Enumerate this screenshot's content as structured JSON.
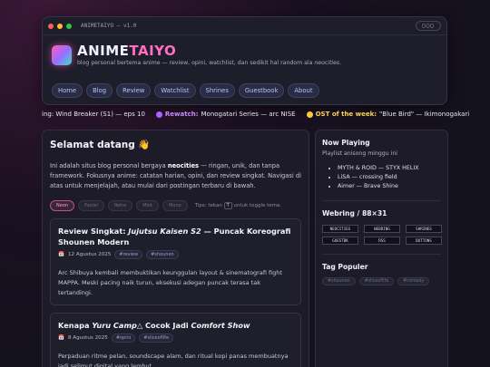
{
  "window": {
    "title": "ANIMETAIYO — v1.0",
    "controls": "▢▢▢",
    "dots": [
      "#ff5f57",
      "#febc2e",
      "#28c840"
    ]
  },
  "brand": {
    "name_a": "ANIME",
    "name_b": "TAIYO",
    "tagline_pre": "blog personal bertema anime — review, opini, watchlist, dan sedikit hal random ala ",
    "tagline_em": "neocities",
    "tagline_post": "."
  },
  "nav": [
    "Home",
    "Blog",
    "Review",
    "Watchlist",
    "Shrines",
    "Guestbook",
    "About"
  ],
  "ticker": [
    {
      "label": "",
      "text": "ing: Wind Breaker (S1) — eps 10",
      "dot": ""
    },
    {
      "label": "Rewatch:",
      "text": "Monogatari Series — arc NISE",
      "dot": "#b060ff"
    },
    {
      "label": "OST of the week:",
      "text": "\"Blue Bird\" — Ikimonogakari",
      "dot": "#ffc83c"
    }
  ],
  "main": {
    "title": "Selamat datang 👋",
    "intro_pre": "Ini adalah situs blog personal bergaya ",
    "intro_bold": "neocities",
    "intro_post": " — ringan, unik, dan tanpa framework. Fokusnya anime: catatan harian, opini, dan review singkat. Navigasi di atas untuk menjelajah, atau mulai dari postingan terbaru di bawah.",
    "themes": [
      "Neon",
      "Pastel",
      "Retro",
      "Mint",
      "Mono"
    ],
    "tip_pre": "Tips: tekan",
    "tip_key": "T",
    "tip_post": "untuk toggle tema."
  },
  "posts": [
    {
      "title_pre": "Review Singkat: ",
      "title_em": "Jujutsu Kaisen S2",
      "title_post": " — Puncak Koreografi Shounen Modern",
      "date": "12 Agustus 2025",
      "tags": [
        "#review",
        "#shounen"
      ],
      "excerpt": "Arc Shibuya kembali membuktikan keunggulan layout & sinematografi fight MAPPA. Meski pacing naik turun, eksekusi adegan puncak terasa tak tertandingi."
    },
    {
      "title_pre": "Kenapa ",
      "title_em": "Yuru Camp△",
      "title_mid": " Cocok Jadi ",
      "title_em2": "Comfort Show",
      "date": "8 Agustus 2025",
      "tags": [
        "#opini",
        "#sliceoflife"
      ],
      "excerpt": "Perpaduan ritme pelan, soundscape alam, dan ritual kopi panas membuatnya jadi selimut digital yang lembut."
    }
  ],
  "sidebar": {
    "now_playing_title": "Now Playing",
    "now_playing_sub": "Playlist anisong minggu ini",
    "songs": [
      "MYTH & ROID — STYX HELIX",
      "LiSA — crossing field",
      "Aimer — Brave Shine"
    ],
    "webring_title": "Webring / 88×31",
    "webring": [
      "NEOCITIES",
      "WEBRING",
      "SHRINES",
      "GUESTBK",
      "RSS",
      "BUTTONS"
    ],
    "tags_title": "Tag Populer",
    "tags": [
      "#shounen",
      "#sliceoflife",
      "#comedy"
    ]
  },
  "colors": {
    "accent": "#ff6fc0",
    "link": "#b6c4ff",
    "bg": "#14121c"
  }
}
